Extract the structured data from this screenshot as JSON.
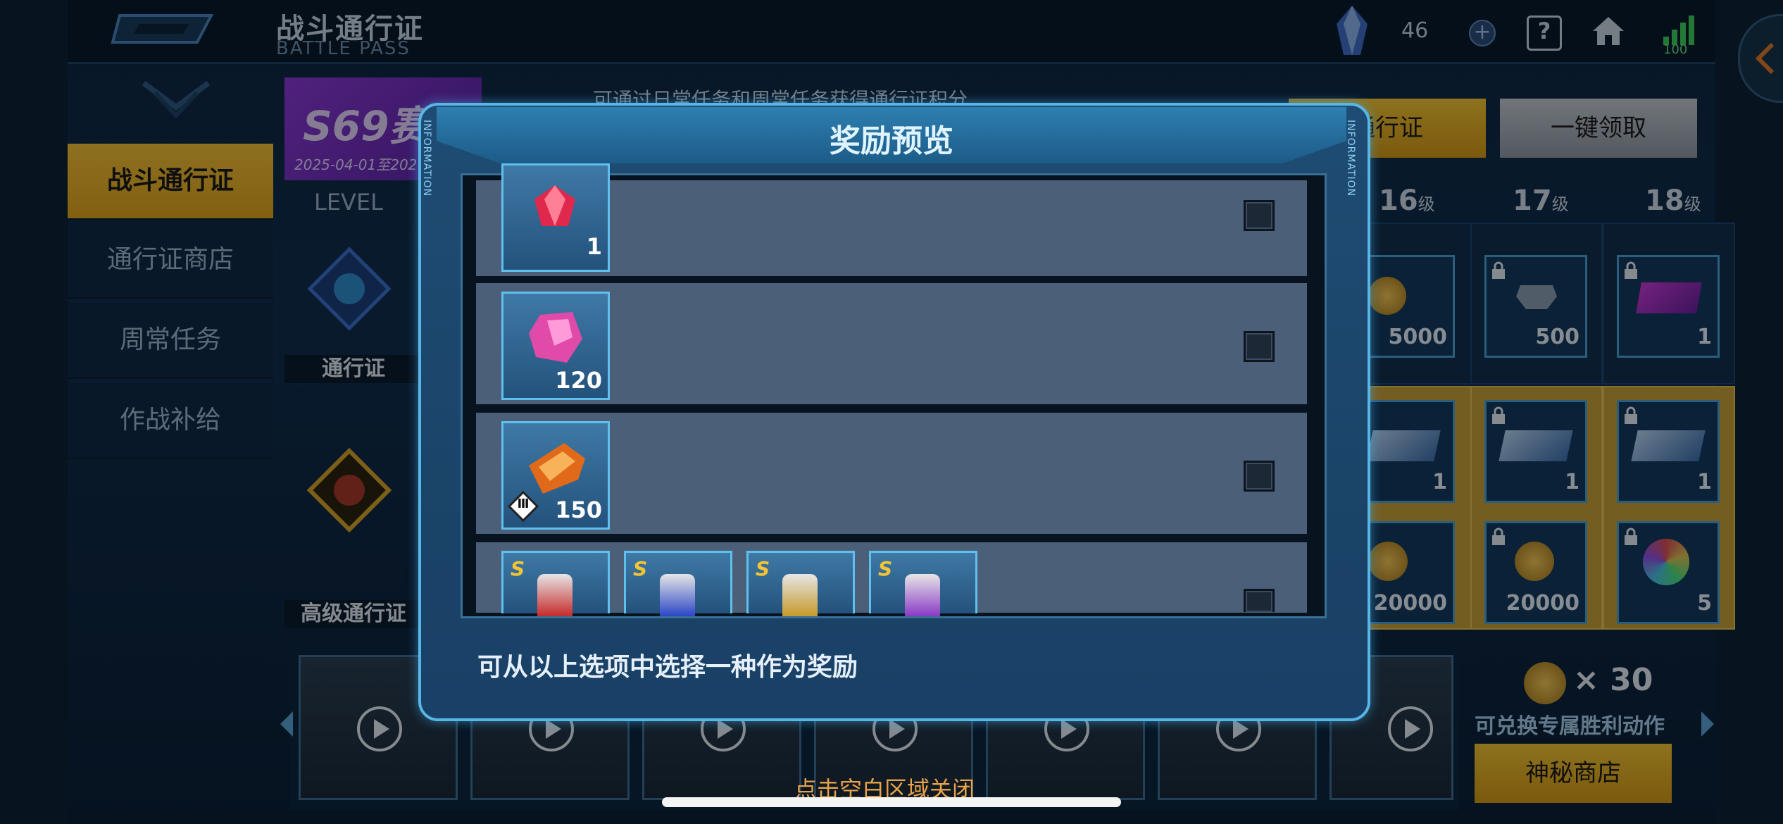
{
  "header": {
    "title_cn": "战斗通行证",
    "title_en": "BATTLE PASS",
    "crystal_count": "46",
    "plus_label": "+",
    "help_label": "?",
    "signal_value": "100"
  },
  "sidebar": {
    "items": [
      {
        "label": "战斗通行证",
        "active": true
      },
      {
        "label": "通行证商店",
        "active": false
      },
      {
        "label": "周常任务",
        "active": false
      },
      {
        "label": "作战补给",
        "active": false
      }
    ]
  },
  "season": {
    "name": "S69赛",
    "date": "2025-04-01至202"
  },
  "hint_top": "可通过日常任务和周常任务获得通行证积分",
  "buttons": {
    "buy": "通行证",
    "collect": "一键领取",
    "shop": "神秘商店"
  },
  "track": {
    "level_label": "LEVEL",
    "free_label": "通行证",
    "premium_label": "高级通行证",
    "level_suffix": "级",
    "levels": [
      {
        "level": "16",
        "free": "5000",
        "prem_top": "1",
        "prem_bottom": "20000",
        "free_locked": false,
        "prem_locked": false
      },
      {
        "level": "17",
        "free": "500",
        "prem_top": "1",
        "prem_bottom": "20000",
        "free_locked": true,
        "prem_locked": true
      },
      {
        "level": "18",
        "free": "1",
        "prem_top": "1",
        "prem_bottom": "5",
        "free_locked": true,
        "prem_locked": true
      }
    ]
  },
  "mystery_shop": {
    "multiplier": "× 30",
    "hint": "可兑换专属胜利动作"
  },
  "modal": {
    "title": "奖励预览",
    "side_tag": "INFORMATION",
    "options": [
      {
        "icon": "red-gem-icon",
        "count": "1"
      },
      {
        "icon": "pink-crystal-icon",
        "count": "120"
      },
      {
        "icon": "armor-part-icon",
        "count": "150",
        "tier": "Ⅲ"
      },
      {
        "icon": "s-grade-canister-icons",
        "count": ""
      }
    ],
    "hint": "可从以上选项中选择一种作为奖励",
    "canister_badge": "S"
  },
  "close_hint": "点击空白区域关闭",
  "colors": {
    "accent_gold": "#f3c534",
    "modal_border": "#58b6e6",
    "option_bg": "#4b5f78",
    "close_hint": "#e8a24a"
  }
}
